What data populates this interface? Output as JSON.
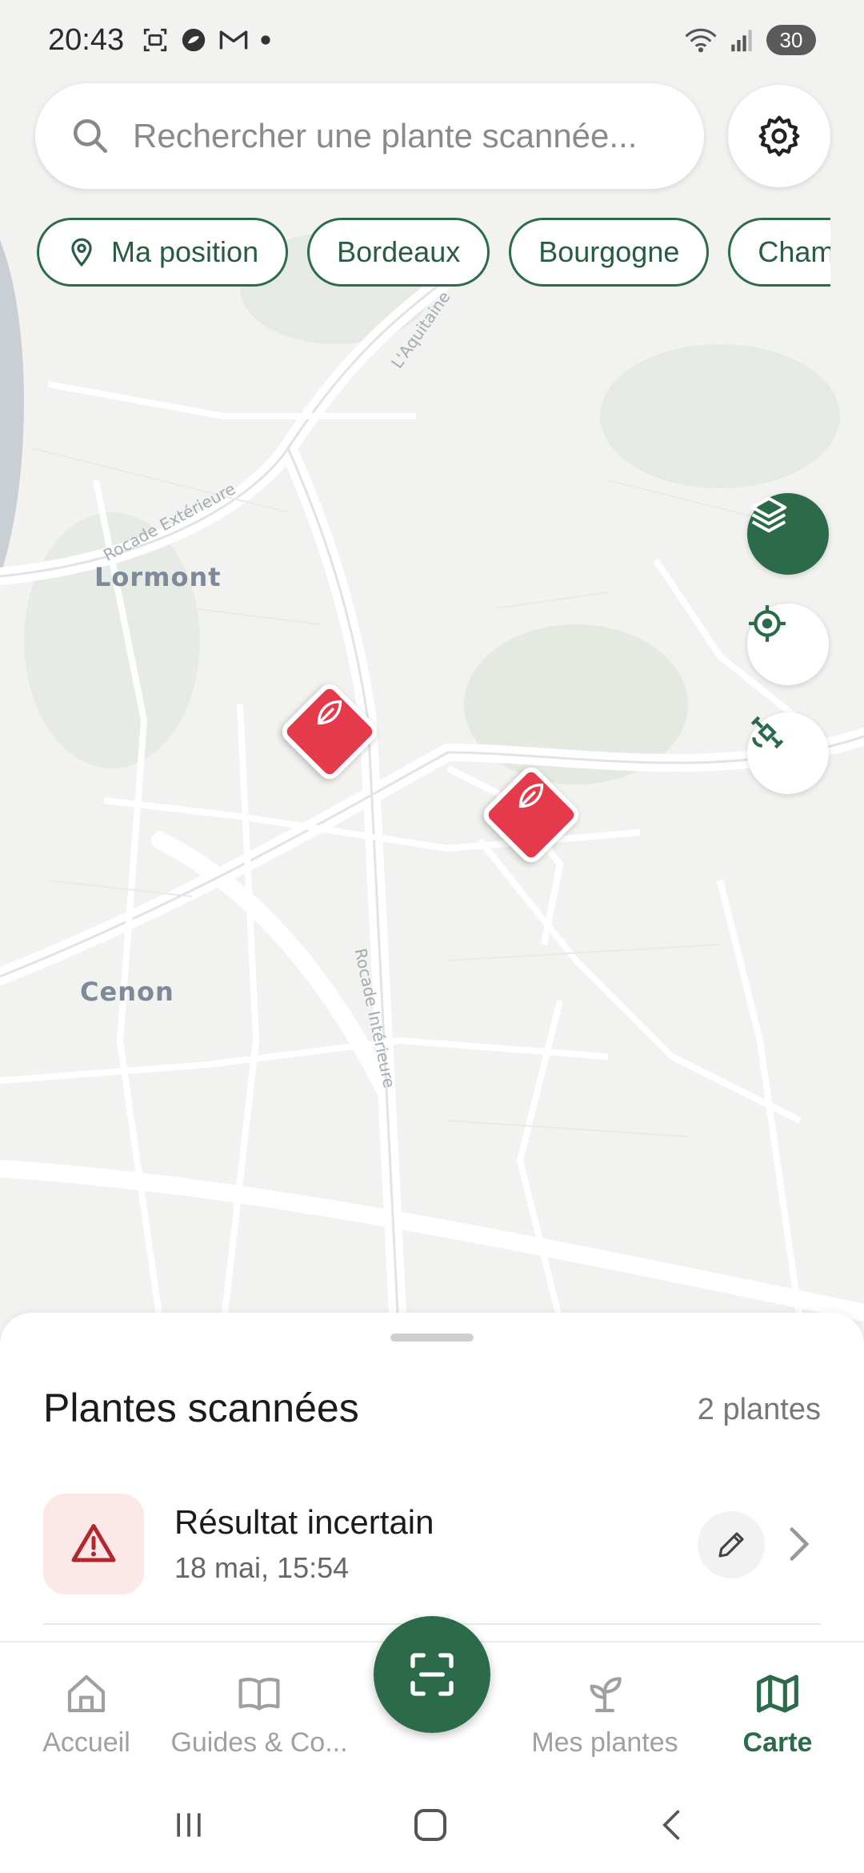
{
  "status_bar": {
    "time": "20:43",
    "battery": "30",
    "icons_left": [
      "screenshot-icon",
      "app-icon",
      "gmail-icon",
      "dot-icon"
    ],
    "icons_right": [
      "wifi-icon",
      "signal-icon",
      "battery-icon"
    ]
  },
  "search": {
    "placeholder": "Rechercher une plante scannée...",
    "icon": "search-icon"
  },
  "settings": {
    "icon": "gear-icon"
  },
  "chips": [
    {
      "label": "Ma position",
      "icon": "location-pin-icon"
    },
    {
      "label": "Bordeaux"
    },
    {
      "label": "Bourgogne"
    },
    {
      "label": "Champ"
    }
  ],
  "map": {
    "place_labels": [
      "Lormont",
      "Cenon"
    ],
    "road_labels": [
      "Rocade Extérieure",
      "L'Aquitaine",
      "Rocade Intérieure"
    ],
    "markers": [
      {
        "icon": "leaf-icon",
        "color": "#e53a4b"
      },
      {
        "icon": "leaf-icon",
        "color": "#e53a4b"
      }
    ],
    "controls": [
      "layers-icon",
      "crosshair-icon",
      "satellite-icon"
    ]
  },
  "sheet": {
    "title": "Plantes scannées",
    "count": "2 plantes",
    "items": [
      {
        "title": "Résultat incertain",
        "date": "18 mai, 15:54",
        "icon": "warning-icon"
      }
    ]
  },
  "navbar": {
    "items": [
      {
        "label": "Accueil",
        "icon": "home-icon",
        "active": false
      },
      {
        "label": "Guides & Co...",
        "icon": "book-icon",
        "active": false
      },
      {
        "label": "Mes plantes",
        "icon": "sprout-icon",
        "active": false
      },
      {
        "label": "Carte",
        "icon": "map-icon",
        "active": true
      }
    ],
    "scan_icon": "scan-icon"
  },
  "colors": {
    "accent": "#2c6b4a",
    "marker": "#e53a4b",
    "warning_bg": "#fde8e8"
  }
}
